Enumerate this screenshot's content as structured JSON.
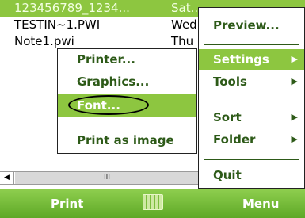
{
  "file_list": {
    "rows": [
      {
        "name": "123456789_1234...",
        "date": "Sat..."
      },
      {
        "name": "TESTIN~1.PWI",
        "date": "Wed"
      },
      {
        "name": "Note1.pwi",
        "date": "Thu"
      }
    ]
  },
  "scrollbar": {
    "left_arrow": "◀",
    "thumb_grip": "III"
  },
  "main_menu": {
    "items": [
      {
        "label": "Preview..."
      },
      {
        "label": "Settings",
        "arrow": "▶"
      },
      {
        "label": "Tools",
        "arrow": "▶"
      },
      {
        "label": "Sort",
        "arrow": "▶"
      },
      {
        "label": "Folder",
        "arrow": "▶"
      },
      {
        "label": "Quit"
      }
    ]
  },
  "sub_menu": {
    "items": [
      {
        "label": "Printer..."
      },
      {
        "label": "Graphics..."
      },
      {
        "label": "Font..."
      },
      {
        "label": "Print as image"
      }
    ]
  },
  "softkeys": {
    "left": "Print",
    "right": "Menu",
    "center_icon": "keyboard-icon"
  },
  "colors": {
    "accent": "#8dc640",
    "menu_text": "#2d5a18",
    "softkey_bar": "#6db634"
  }
}
